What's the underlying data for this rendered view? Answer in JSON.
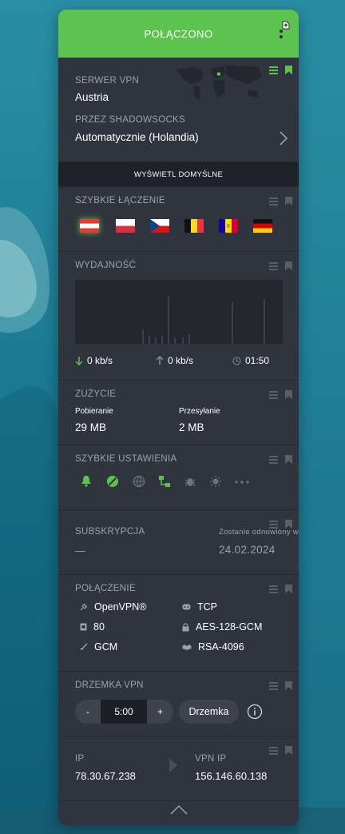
{
  "header": {
    "title": "POŁĄCZONO"
  },
  "server": {
    "label": "SERWER VPN",
    "country": "Austria",
    "via_label": "PRZEZ SHADOWSOCKS",
    "via_value": "Automatycznie (Holandia)",
    "show_defaults": "WYŚWIETL DOMYŚLNE"
  },
  "quick_connect": {
    "label": "SZYBKIE ŁĄCZENIE",
    "flags": [
      "austria-flag",
      "poland-flag",
      "czech-flag",
      "belgium-flag",
      "andorra-flag",
      "germany-flag"
    ]
  },
  "performance": {
    "label": "WYDAJNOŚĆ",
    "download": "0 kb/s",
    "upload": "0 kb/s",
    "time": "01:50"
  },
  "usage": {
    "label": "ZUŻYCIE",
    "download_label": "Pobieranie",
    "download_value": "29 MB",
    "upload_label": "Przesyłanie",
    "upload_value": "2 MB"
  },
  "quick_settings": {
    "label": "SZYBKIE USTAWIENIA"
  },
  "subscription": {
    "label": "SUBSKRYPCJA",
    "value": "—",
    "renew_label": "Zostanie odnowiony w",
    "renew_date": "24.02.2024"
  },
  "connection": {
    "label": "POŁĄCZENIE",
    "protocol": "OpenVPN®",
    "transport": "TCP",
    "port": "80",
    "cipher": "AES-128-GCM",
    "auth": "GCM",
    "handshake": "RSA-4096"
  },
  "snooze": {
    "label": "DRZEMKA VPN",
    "minus": "-",
    "value": "5:00",
    "plus": "+",
    "button": "Drzemka"
  },
  "ip": {
    "ip_label": "IP",
    "ip_value": "78.30.67.238",
    "vpn_label": "VPN IP",
    "vpn_value": "156.146.60.138"
  },
  "colors": {
    "accent": "#5cc34e",
    "panel": "#30343e",
    "muted": "#9ca1ad"
  }
}
